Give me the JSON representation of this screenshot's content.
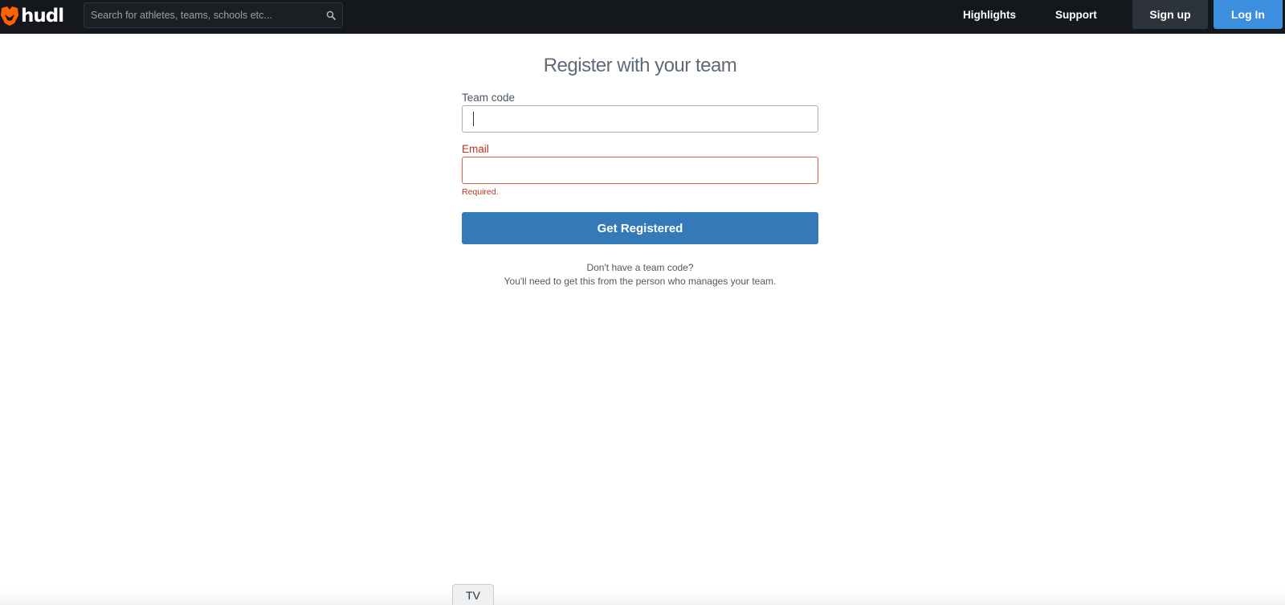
{
  "header": {
    "logo_text": "hudl",
    "search": {
      "placeholder": "Search for athletes, teams, schools etc...",
      "value": ""
    },
    "nav": {
      "highlights": "Highlights",
      "support": "Support"
    },
    "signup_label": "Sign up",
    "login_label": "Log In"
  },
  "form": {
    "title": "Register with your team",
    "team_code": {
      "label": "Team code",
      "value": ""
    },
    "email": {
      "label": "Email",
      "value": "",
      "error": "Required."
    },
    "submit_label": "Get Registered",
    "help": {
      "line1": "Don't have a team code?",
      "line2": "You'll need to get this from the person who manages your team."
    }
  },
  "bottom": {
    "tv_label": "TV"
  },
  "colors": {
    "topbar": "#14171b",
    "brand_orange": "#ff6300",
    "login_blue": "#3b8fde",
    "register_blue": "#357ab8",
    "error_red": "#b83320"
  }
}
